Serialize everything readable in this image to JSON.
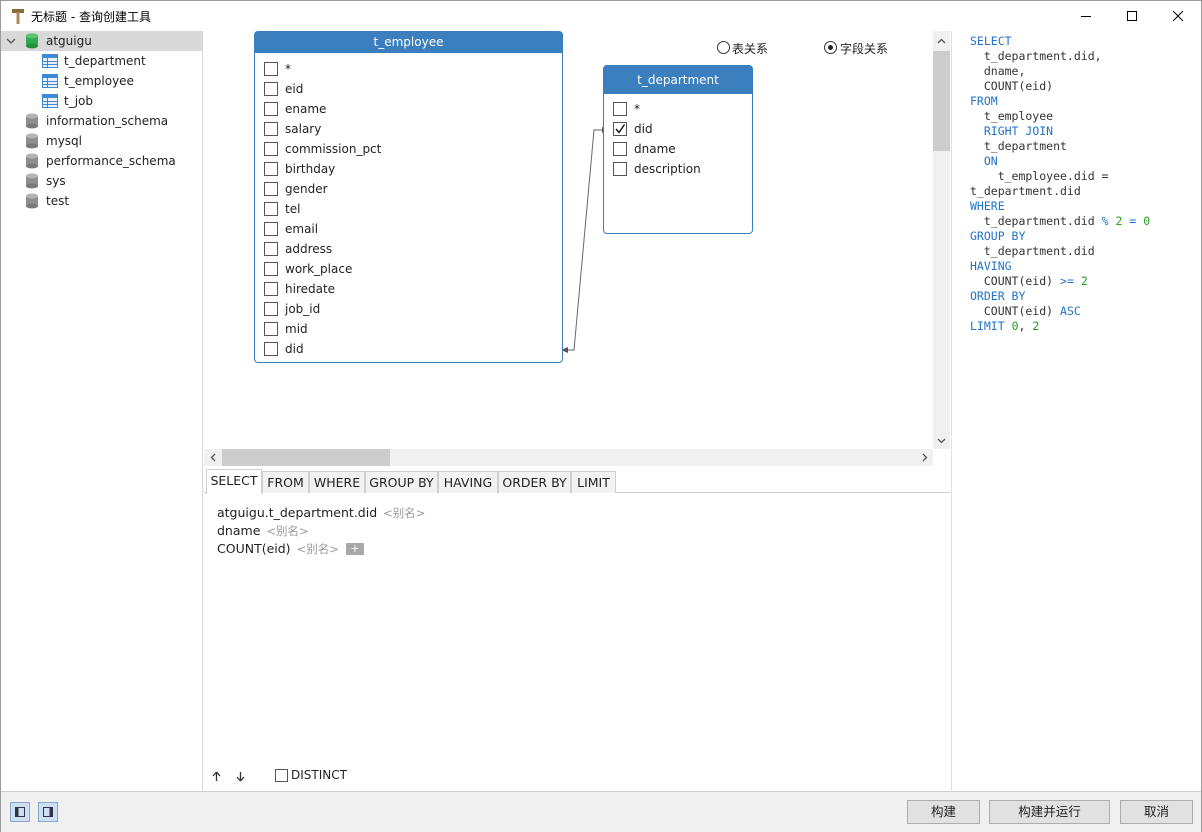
{
  "window": {
    "title": "无标题 - 查询创建工具"
  },
  "tree": {
    "items": [
      {
        "label": "atguigu",
        "icon": "database-green-icon"
      },
      {
        "label": "t_department",
        "icon": "table-icon"
      },
      {
        "label": "t_employee",
        "icon": "table-icon"
      },
      {
        "label": "t_job",
        "icon": "table-icon"
      },
      {
        "label": "information_schema",
        "icon": "database-gray-icon"
      },
      {
        "label": "mysql",
        "icon": "database-gray-icon"
      },
      {
        "label": "performance_schema",
        "icon": "database-gray-icon"
      },
      {
        "label": "sys",
        "icon": "database-gray-icon"
      },
      {
        "label": "test",
        "icon": "database-gray-icon"
      }
    ]
  },
  "relation_mode": {
    "table_relation": "表关系",
    "field_relation": "字段关系",
    "selected": "字段关系"
  },
  "entities": {
    "employee": {
      "title": "t_employee",
      "fields": [
        "*",
        "eid",
        "ename",
        "salary",
        "commission_pct",
        "birthday",
        "gender",
        "tel",
        "email",
        "address",
        "work_place",
        "hiredate",
        "job_id",
        "mid",
        "did"
      ],
      "checked": []
    },
    "department": {
      "title": "t_department",
      "fields": [
        "*",
        "did",
        "dname",
        "description"
      ],
      "checked": [
        "did"
      ]
    }
  },
  "sql": {
    "lines": [
      "<span class=\"kw\">SELECT</span>",
      "  t_department.did,",
      "  dname,",
      "  COUNT(eid)",
      "<span class=\"kw\">FROM</span>",
      "  t_employee",
      "  <span class=\"kw\">RIGHT JOIN</span>",
      "  t_department",
      "  <span class=\"kw\">ON</span>",
      "    t_employee.did =",
      "t_department.did",
      "<span class=\"kw\">WHERE</span>",
      "  t_department.did <span class=\"kw\">%</span> <span class=\"num\">2</span> <span class=\"kw\">=</span> <span class=\"num\">0</span>",
      "<span class=\"kw\">GROUP BY</span>",
      "  t_department.did",
      "<span class=\"kw\">HAVING</span>",
      "  COUNT(eid) <span class=\"kw\">&gt;=</span> <span class=\"num\">2</span>",
      "<span class=\"kw\">ORDER BY</span>",
      "  COUNT(eid) <span class=\"kw\">ASC</span>",
      "<span class=\"kw\">LIMIT</span> <span class=\"num\">0</span>, <span class=\"num\">2</span>"
    ]
  },
  "tabs": [
    "SELECT",
    "FROM",
    "WHERE",
    "GROUP BY",
    "HAVING",
    "ORDER BY",
    "LIMIT"
  ],
  "active_tab": "SELECT",
  "select_items": [
    {
      "field": "atguigu.t_department.did",
      "alias": "<别名>"
    },
    {
      "field": "dname",
      "alias": "<别名>"
    },
    {
      "field": "COUNT(eid)",
      "alias": "<别名>"
    }
  ],
  "add_label": "+",
  "distinct_label": "DISTINCT",
  "buttons": {
    "build": "构建",
    "build_run": "构建并运行",
    "cancel": "取消"
  },
  "colors": {
    "entity_header": "#3c7fbf",
    "keyword": "#1f73c9",
    "number": "#22a022"
  }
}
